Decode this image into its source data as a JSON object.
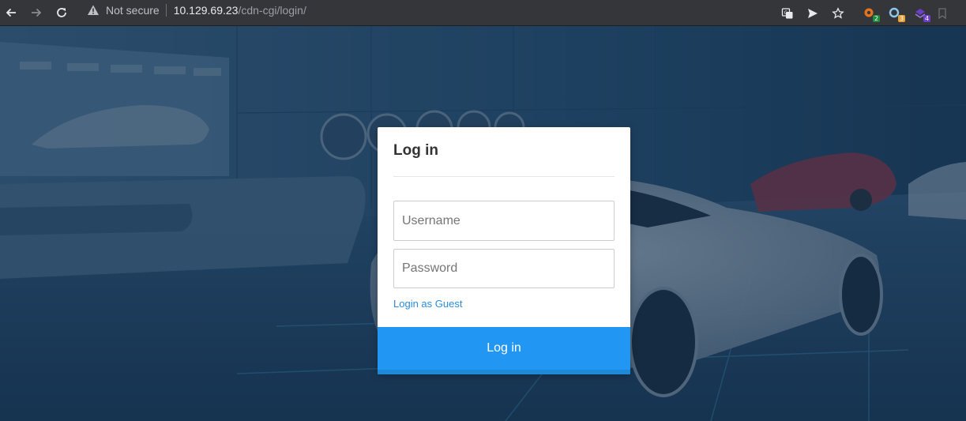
{
  "browser": {
    "security_label": "Not secure",
    "url_host": "10.129.69.23",
    "url_path": "/cdn-cgi/login/",
    "extensions": [
      {
        "name": "extension-1",
        "badge": "2",
        "badge_color": "#1e8e3e"
      },
      {
        "name": "extension-2",
        "badge": "3",
        "badge_color": "#e8a33d"
      },
      {
        "name": "extension-3",
        "badge": "4",
        "badge_color": "#6a3fc7"
      }
    ]
  },
  "login": {
    "title": "Log in",
    "username_placeholder": "Username",
    "password_placeholder": "Password",
    "guest_link": "Login as Guest",
    "submit_label": "Log in"
  },
  "colors": {
    "accent": "#2196f3",
    "link": "#2b8bd8",
    "overlay": "#102d4b"
  }
}
